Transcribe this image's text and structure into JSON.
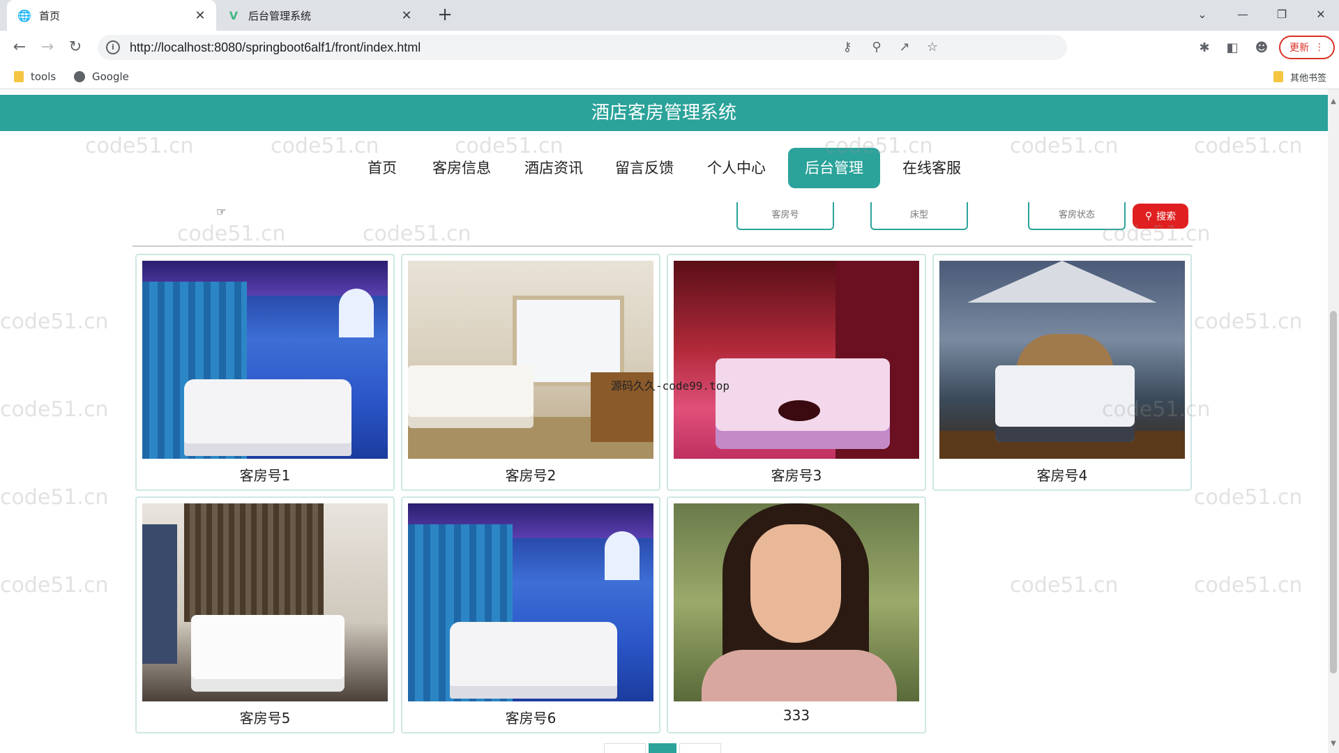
{
  "browser": {
    "tabs": [
      {
        "title": "首页",
        "icon": "globe-icon"
      },
      {
        "title": "后台管理系统",
        "icon": "vue-icon"
      }
    ],
    "url": "http://localhost:8080/springboot6alf1/front/index.html",
    "update_label": "更新",
    "bookmarks": [
      {
        "label": "tools",
        "icon": "folder-icon"
      },
      {
        "label": "Google",
        "icon": "globe-icon"
      }
    ],
    "other_bookmarks": "其他书签"
  },
  "site": {
    "title": "酒店客房管理系统",
    "nav": [
      {
        "label": "首页",
        "active": false
      },
      {
        "label": "客房信息",
        "active": false
      },
      {
        "label": "酒店资讯",
        "active": false
      },
      {
        "label": "留言反馈",
        "active": false
      },
      {
        "label": "个人中心",
        "active": false
      },
      {
        "label": "后台管理",
        "active": true
      },
      {
        "label": "在线客服",
        "active": false
      }
    ],
    "search": {
      "room_no_placeholder": "客房号",
      "bed_type_placeholder": "床型",
      "status_placeholder": "客房状态",
      "button_label": "搜索"
    },
    "rooms": [
      {
        "caption": "客房号1",
        "scene": "blue"
      },
      {
        "caption": "客房号2",
        "scene": "beige"
      },
      {
        "caption": "客房号3",
        "scene": "red"
      },
      {
        "caption": "客房号4",
        "scene": "dark"
      },
      {
        "caption": "客房号5",
        "scene": "modern"
      },
      {
        "caption": "客房号6",
        "scene": "blue"
      },
      {
        "caption": "333",
        "scene": "portrait"
      }
    ],
    "overlay_text": "源码久久-code99.top",
    "watermark": "code51.cn"
  },
  "colors": {
    "accent": "#2ba39a",
    "search_button": "#e02020"
  }
}
